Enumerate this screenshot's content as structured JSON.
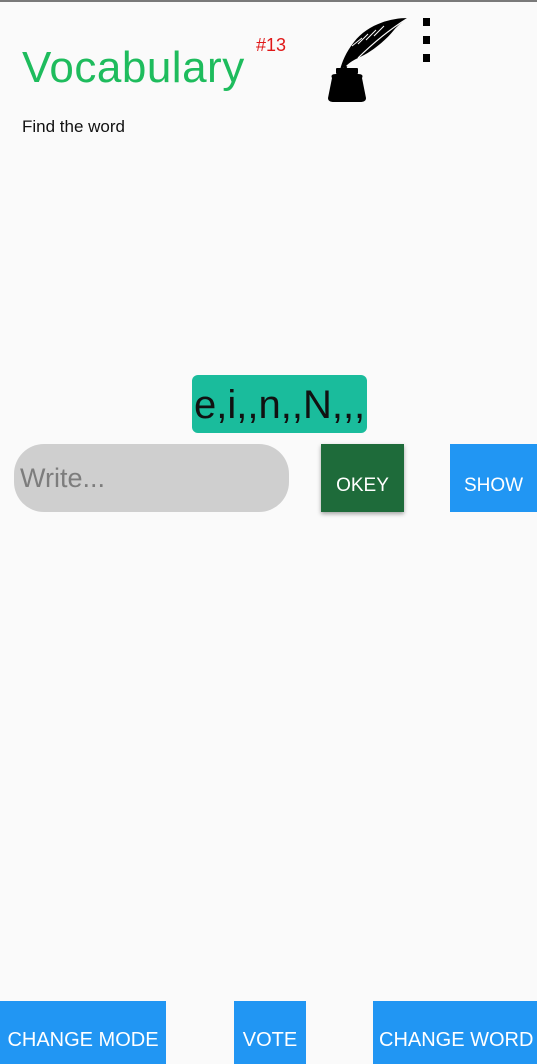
{
  "header": {
    "title": "Vocabulary",
    "counter": "#13",
    "logo_icon": "quill-inkwell-icon",
    "menu_icon": "more-vert-icon"
  },
  "subtitle": "Find the word",
  "puzzle": {
    "scrambled_letters": "e,i,,n,,N,,,"
  },
  "answer": {
    "value": "",
    "placeholder": "Write..."
  },
  "actions": {
    "okey_label": "OKEY",
    "show_label": "SHOW"
  },
  "bottom_bar": {
    "change_mode_label": "CHANGE MODE",
    "vote_label": "VOTE",
    "change_word_label": "CHANGE WORD"
  },
  "colors": {
    "title": "#1ebc5d",
    "counter": "#e01818",
    "scramble_bg": "#1abc9c",
    "okey_bg": "#1e6b3a",
    "accent_blue": "#2196f3",
    "input_bg": "#cfcfcf",
    "background": "#fafafa"
  }
}
